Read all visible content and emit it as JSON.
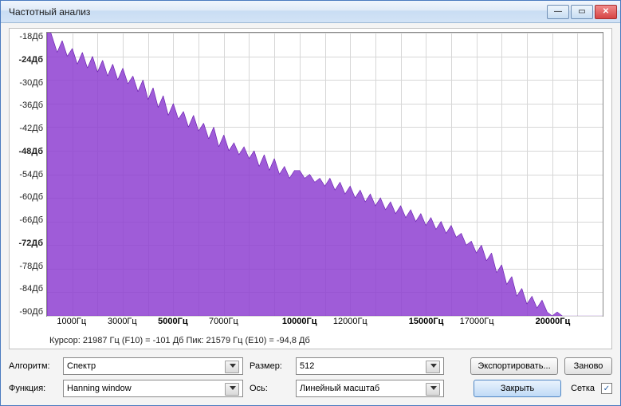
{
  "window": {
    "title": "Частотный анализ"
  },
  "yaxis": {
    "ticks": [
      {
        "label": "-18Дб",
        "bold": false
      },
      {
        "label": "-24Дб",
        "bold": true
      },
      {
        "label": "-30Дб",
        "bold": false
      },
      {
        "label": "-36Дб",
        "bold": false
      },
      {
        "label": "-42Дб",
        "bold": false
      },
      {
        "label": "-48Дб",
        "bold": true
      },
      {
        "label": "-54Дб",
        "bold": false
      },
      {
        "label": "-60Дб",
        "bold": false
      },
      {
        "label": "-66Дб",
        "bold": false
      },
      {
        "label": "-72Дб",
        "bold": true
      },
      {
        "label": "-78Дб",
        "bold": false
      },
      {
        "label": "-84Дб",
        "bold": false
      },
      {
        "label": "-90Дб",
        "bold": false
      }
    ]
  },
  "xaxis": {
    "ticks": [
      {
        "label": "1000Гц",
        "pos": 4.55,
        "bold": false
      },
      {
        "label": "3000Гц",
        "pos": 13.64,
        "bold": false
      },
      {
        "label": "5000Гц",
        "pos": 22.73,
        "bold": true
      },
      {
        "label": "7000Гц",
        "pos": 31.82,
        "bold": false
      },
      {
        "label": "10000Гц",
        "pos": 45.45,
        "bold": true
      },
      {
        "label": "12000Гц",
        "pos": 54.55,
        "bold": false
      },
      {
        "label": "15000Гц",
        "pos": 68.18,
        "bold": true
      },
      {
        "label": "17000Гц",
        "pos": 77.27,
        "bold": false
      },
      {
        "label": "20000Гц",
        "pos": 90.91,
        "bold": true
      }
    ]
  },
  "status": {
    "line": "Курсор: 21987 Гц (F10) = -101 Дб    Пик: 21579 Гц (E10) = -94,8 Дб"
  },
  "controls": {
    "algorithm_label": "Алгоритм:",
    "algorithm_value": "Спектр",
    "size_label": "Размер:",
    "size_value": "512",
    "export_label": "Экспортировать...",
    "again_label": "Заново",
    "function_label": "Функция:",
    "function_value": "Hanning window",
    "axis_label": "Ось:",
    "axis_value": "Линейный масштаб",
    "close_label": "Закрыть",
    "grid_label": "Сетка",
    "grid_checked": "✓"
  },
  "chart_data": {
    "type": "area",
    "title": "Частотный анализ",
    "xlabel": "Гц",
    "ylabel": "Дб",
    "xlim": [
      0,
      22000
    ],
    "ylim": [
      -90,
      -18
    ],
    "x": [
      0,
      200,
      400,
      600,
      800,
      1000,
      1200,
      1400,
      1600,
      1800,
      2000,
      2200,
      2400,
      2600,
      2800,
      3000,
      3200,
      3400,
      3600,
      3800,
      4000,
      4200,
      4400,
      4600,
      4800,
      5000,
      5200,
      5400,
      5600,
      5800,
      6000,
      6200,
      6400,
      6600,
      6800,
      7000,
      7200,
      7400,
      7600,
      7800,
      8000,
      8200,
      8400,
      8600,
      8800,
      9000,
      9200,
      9400,
      9600,
      9800,
      10000,
      10200,
      10400,
      10600,
      10800,
      11000,
      11200,
      11400,
      11600,
      11800,
      12000,
      12200,
      12400,
      12600,
      12800,
      13000,
      13200,
      13400,
      13600,
      13800,
      14000,
      14200,
      14400,
      14600,
      14800,
      15000,
      15200,
      15400,
      15600,
      15800,
      16000,
      16200,
      16400,
      16600,
      16800,
      17000,
      17200,
      17400,
      17600,
      17800,
      18000,
      18200,
      18400,
      18600,
      18800,
      19000,
      19200,
      19400,
      19600,
      19800,
      20000,
      20200,
      20400,
      20600,
      20800,
      21000,
      21200,
      21400,
      21579,
      21800,
      21987
    ],
    "values": [
      -15,
      -19,
      -23,
      -20,
      -24,
      -22,
      -26,
      -23,
      -27,
      -24,
      -28,
      -25,
      -29,
      -26,
      -30,
      -27,
      -31,
      -29,
      -33,
      -30,
      -35,
      -32,
      -37,
      -34,
      -39,
      -36,
      -40,
      -38,
      -42,
      -39,
      -43,
      -41,
      -45,
      -42,
      -47,
      -44,
      -48,
      -46,
      -49,
      -47,
      -50,
      -48,
      -52,
      -49,
      -53,
      -50,
      -54,
      -52,
      -55,
      -53,
      -53,
      -55,
      -54,
      -56,
      -55,
      -57,
      -55,
      -58,
      -56,
      -59,
      -57,
      -60,
      -58,
      -61,
      -59,
      -62,
      -60,
      -63,
      -61,
      -64,
      -62,
      -65,
      -63,
      -66,
      -64,
      -67,
      -65,
      -68,
      -66,
      -69,
      -67,
      -70,
      -69,
      -72,
      -71,
      -74,
      -72,
      -76,
      -74,
      -79,
      -77,
      -82,
      -80,
      -85,
      -83,
      -87,
      -85,
      -88,
      -86,
      -89,
      -90,
      -89,
      -90,
      -90,
      -90,
      -90,
      -92,
      -93,
      -94.8,
      -97,
      -101
    ]
  }
}
